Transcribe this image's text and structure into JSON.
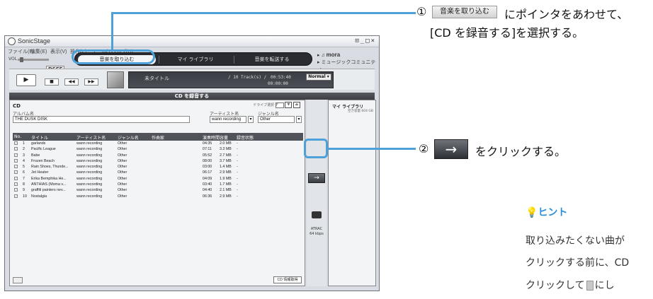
{
  "window": {
    "title": "SonicStage",
    "controls": "⊡_□×",
    "menu": [
      "ファイル(F)",
      "編集(E)",
      "表示(V)",
      "操作(P)",
      "ツール(T)",
      "ヘルプ(H)"
    ],
    "volume_label": "VOL",
    "dsee_label": "DSEE"
  },
  "tasks": [
    {
      "label": "音楽を取り込む",
      "active": true
    },
    {
      "label": "マイ ライブラリ",
      "active": false
    },
    {
      "label": "音楽を転送する",
      "active": false
    }
  ],
  "links": {
    "mora": "mora",
    "community": "ミュージックコミュニティ"
  },
  "player": {
    "title": "未タイトル",
    "track_count": "/ 10 Track(s) /",
    "total_time": "00:53:40",
    "position": "00:00:00",
    "mode": "Normal"
  },
  "record_panel": {
    "header": "CD を録音する",
    "source": "CD",
    "drive_label": "ドライブ選択",
    "drive_value": "F",
    "album_label": "アルバム名",
    "album_value": "THE DUSK DISK",
    "artist_label": "アーティスト名",
    "artist_value": "wann recording",
    "genre_label": "ジャンル名",
    "genre_value": "Other",
    "columns": [
      "No.",
      "タイトル",
      "アーティスト名",
      "ジャンル名",
      "作曲家",
      "演奏時間",
      "容量",
      "録音状態"
    ],
    "tracks": [
      {
        "no": "1",
        "title": "garlands",
        "artist": "wann recording",
        "genre": "Other",
        "time": "04:35",
        "size": "2.0 MB",
        "state": "-"
      },
      {
        "no": "2",
        "title": "Pacific League",
        "artist": "wann recording",
        "genre": "Other",
        "time": "07:11",
        "size": "3.3 MB",
        "state": "-"
      },
      {
        "no": "3",
        "title": "Babe",
        "artist": "wann recording",
        "genre": "Other",
        "time": "05:52",
        "size": "2.7 MB",
        "state": "-"
      },
      {
        "no": "4",
        "title": "Frozen Beach",
        "artist": "wann recording",
        "genre": "Other",
        "time": "08:00",
        "size": "3.7 MB",
        "state": "-"
      },
      {
        "no": "5",
        "title": "Rain Shoes, Thunde...",
        "artist": "wann recording",
        "genre": "Other",
        "time": "03:00",
        "size": "1.4 MB",
        "state": "-"
      },
      {
        "no": "6",
        "title": "Jet Heater",
        "artist": "wann recording",
        "genre": "Other",
        "time": "06:17",
        "size": "2.9 MB",
        "state": "-"
      },
      {
        "no": "7",
        "title": "Erika Bemphika He...",
        "artist": "wann recording",
        "genre": "Other",
        "time": "04:09",
        "size": "1.9 MB",
        "state": "-"
      },
      {
        "no": "8",
        "title": "ANTHIAS (Moma v...",
        "artist": "wann recording",
        "genre": "Other",
        "time": "03:40",
        "size": "1.7 MB",
        "state": "-"
      },
      {
        "no": "9",
        "title": "graffiti painters nev...",
        "artist": "wann recording",
        "genre": "Other",
        "time": "04:40",
        "size": "2.1 MB",
        "state": "-"
      },
      {
        "no": "10",
        "title": "Nostalgia",
        "artist": "wann recording",
        "genre": "Other",
        "time": "06:36",
        "size": "2.9 MB",
        "state": "-"
      }
    ],
    "info_button": "CD 情報取得"
  },
  "mid_column": {
    "arrow": "→",
    "format": "ATRAC",
    "bitrate": "64 kbps"
  },
  "library": {
    "title": "マイ ライブラリ",
    "capacity": "空き容量 604 GB"
  },
  "annotations": {
    "step1_num": "①",
    "step1_button": "音楽を取り込む",
    "step1_text_a": "にポインタをあわせて、",
    "step1_text_b": "[CD を録音する]を選択する。",
    "step2_num": "②",
    "step2_arrow": "→",
    "step2_text": "をクリックする。",
    "hint_title": "ヒント",
    "hint_line1": "取り込みたくない曲が",
    "hint_line2": "クリックする前に、CD",
    "hint_line3_a": "クリックして",
    "hint_line3_b": "にし"
  }
}
